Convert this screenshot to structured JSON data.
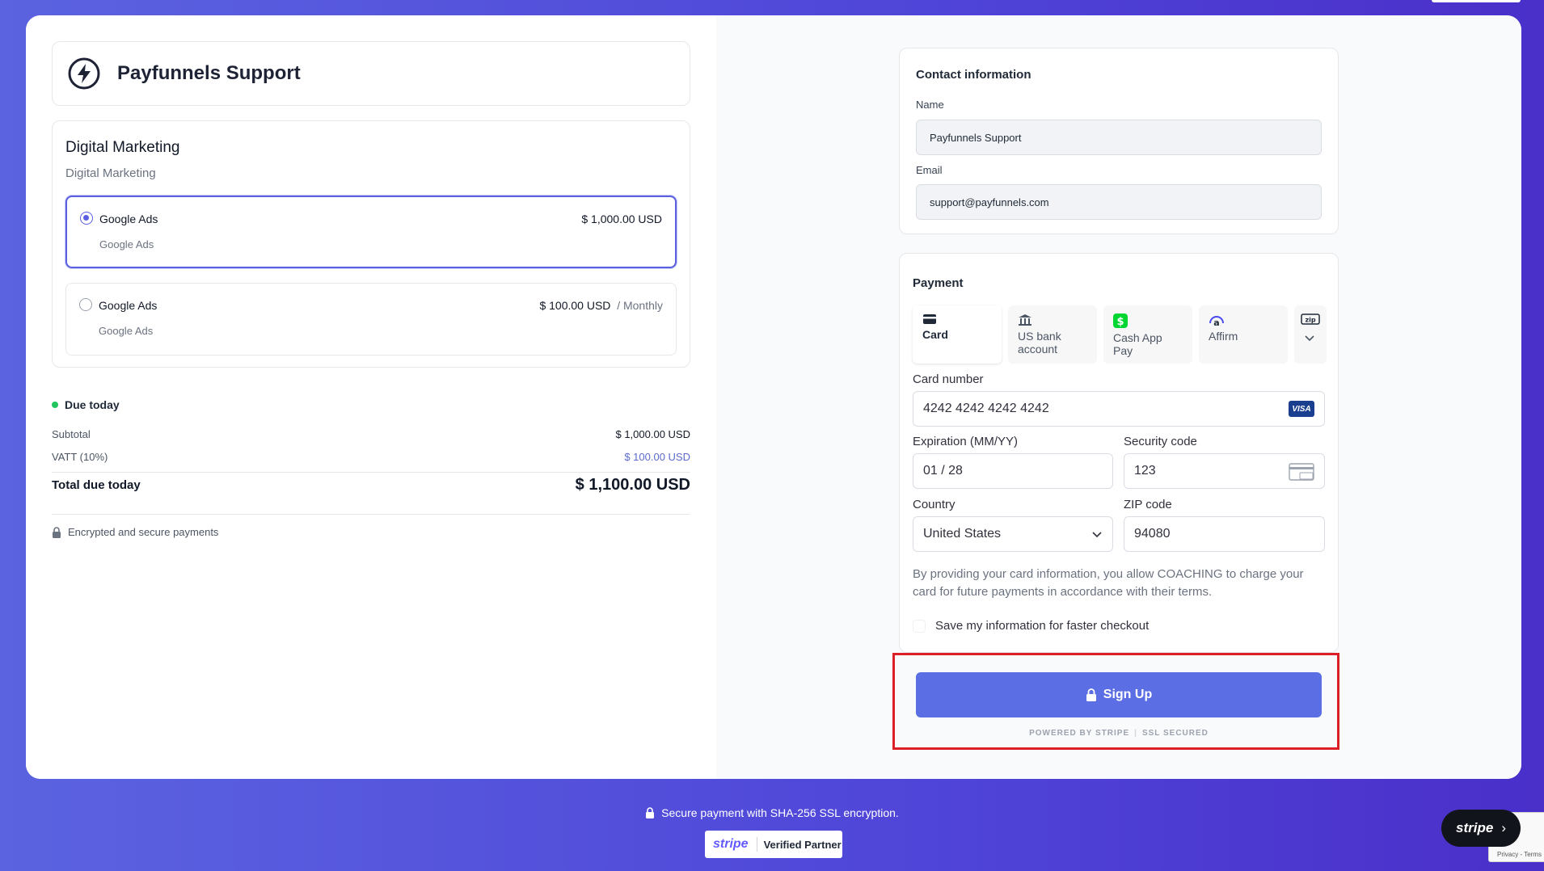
{
  "brand": {
    "name": "Payfunnels Support"
  },
  "product": {
    "title": "Digital Marketing",
    "subtitle": "Digital Marketing",
    "options": [
      {
        "name": "Google Ads",
        "description": "Google Ads",
        "price": "$ 1,000.00 USD",
        "period": "",
        "selected": true
      },
      {
        "name": "Google Ads",
        "description": "Google Ads",
        "price": "$ 100.00 USD",
        "period": "/ Monthly",
        "selected": false
      }
    ]
  },
  "summary": {
    "due_label": "Due today",
    "subtotal_label": "Subtotal",
    "subtotal_value": "$ 1,000.00 USD",
    "tax_label": "VATT (10%)",
    "tax_value": "$ 100.00 USD",
    "total_label": "Total due today",
    "total_value": "$ 1,100.00 USD",
    "secure_note": "Encrypted and secure payments"
  },
  "contact": {
    "title": "Contact information",
    "name_label": "Name",
    "name_value": "Payfunnels Support",
    "email_label": "Email",
    "email_value": "support@payfunnels.com"
  },
  "payment": {
    "title": "Payment",
    "tabs": [
      {
        "label": "Card",
        "icon": "card-icon"
      },
      {
        "label": "US bank account",
        "icon": "bank-icon"
      },
      {
        "label": "Cash App Pay",
        "icon": "cash-app-icon"
      },
      {
        "label": "Affirm",
        "icon": "affirm-icon"
      }
    ],
    "more_tab_icon": "zip-icon",
    "card_number_label": "Card number",
    "card_number_value": "4242 4242 4242 4242",
    "card_brand": "VISA",
    "expiration_label": "Expiration (MM/YY)",
    "expiration_value": "01 / 28",
    "security_label": "Security code",
    "security_value": "123",
    "country_label": "Country",
    "country_value": "United States",
    "zip_label": "ZIP code",
    "zip_value": "94080",
    "consent_text": "By providing your card information, you allow COACHING to charge your card for future payments in accordance with their terms.",
    "save_label": "Save my information for faster checkout"
  },
  "cta": {
    "label": "Sign Up",
    "powered": "POWERED BY STRIPE",
    "ssl": "SSL SECURED"
  },
  "footer": {
    "secure_text": "Secure payment with SHA-256 SSL encryption.",
    "partner_brand": "stripe",
    "partner_text": "Verified Partner",
    "stripe_pill": "stripe",
    "recaptcha_text": "Privacy - Terms"
  },
  "colors": {
    "accent": "#5b6ee3",
    "highlight": "#dc1f26",
    "due_dot": "#22c55e"
  }
}
